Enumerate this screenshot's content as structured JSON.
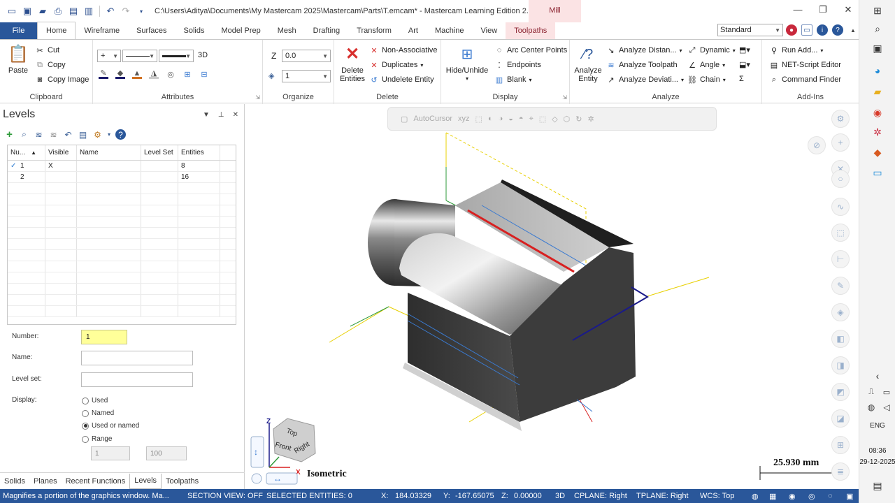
{
  "titlebar": {
    "title": "C:\\Users\\Aditya\\Documents\\My Mastercam 2025\\Mastercam\\Parts\\T.emcam* - Mastercam Learning Edition 2...",
    "context_tab_head": "Mill"
  },
  "tabs": [
    "File",
    "Home",
    "Wireframe",
    "Surfaces",
    "Solids",
    "Model Prep",
    "Mesh",
    "Drafting",
    "Transform",
    "Art",
    "Machine",
    "View",
    "Toolpaths"
  ],
  "workspace_select": "Standard",
  "ribbon": {
    "clipboard": {
      "paste": "Paste",
      "cut": "Cut",
      "copy": "Copy",
      "copy_image": "Copy Image",
      "label": "Clipboard"
    },
    "attributes": {
      "label": "Attributes",
      "dim_mode": "3D"
    },
    "organize": {
      "z_label": "Z",
      "z_value": "0.0",
      "level_value": "1",
      "label": "Organize"
    },
    "delete": {
      "delete_entities": "Delete\nEntities",
      "non_associative": "Non-Associative",
      "duplicates": "Duplicates",
      "undelete_entity": "Undelete Entity",
      "label": "Delete"
    },
    "display": {
      "hide_unhide": "Hide/Unhide",
      "arc_center_points": "Arc Center Points",
      "endpoints": "Endpoints",
      "blank": "Blank",
      "label": "Display"
    },
    "analyze": {
      "analyze_entity": "Analyze\nEntity",
      "analyze_distance": "Analyze Distan...",
      "analyze_toolpath": "Analyze Toolpath",
      "analyze_deviation": "Analyze Deviati...",
      "dynamic": "Dynamic",
      "angle": "Angle",
      "chain": "Chain",
      "label": "Analyze"
    },
    "addins": {
      "run_add": "Run Add...",
      "net_script": "NET-Script Editor",
      "command_finder": "Command Finder",
      "label": "Add-Ins"
    }
  },
  "levels_panel": {
    "title": "Levels",
    "columns": [
      "Nu...",
      "Visible",
      "Name",
      "Level Set",
      "Entities"
    ],
    "rows": [
      {
        "check": "✓",
        "number": "1",
        "visible": "X",
        "name": "",
        "level_set": "",
        "entities": "8"
      },
      {
        "check": "",
        "number": "2",
        "visible": "",
        "name": "",
        "level_set": "",
        "entities": "16"
      }
    ],
    "form": {
      "number_label": "Number:",
      "number_value": "1",
      "name_label": "Name:",
      "name_value": "",
      "level_set_label": "Level set:",
      "level_set_value": "",
      "display_label": "Display:",
      "options": [
        "Used",
        "Named",
        "Used or named",
        "Range"
      ],
      "selected_option": "Used or named",
      "range_from": "1",
      "range_to": "100"
    },
    "bottom_tabs": [
      "Solids",
      "Planes",
      "Recent Functions",
      "Levels",
      "Toolpaths"
    ],
    "active_bottom_tab": "Levels"
  },
  "viewport": {
    "autocursor": "AutoCursor",
    "view_name": "Isometric",
    "scale": "25.930 mm",
    "cube_faces": {
      "top": "Top",
      "front": "Front",
      "right": "Right"
    }
  },
  "statusbar": {
    "hint": "Magnifies a portion of the graphics window. Ma...",
    "section_view": "SECTION VIEW: OFF",
    "selected": "SELECTED ENTITIES: 0",
    "x_label": "X:",
    "x_value": "184.03329",
    "y_label": "Y:",
    "y_value": "-167.65075",
    "z_label": "Z:",
    "z_value": "0.00000",
    "mode": "3D",
    "cplane": "CPLANE: Right",
    "tplane": "TPLANE: Right",
    "wcs": "WCS: Top"
  },
  "taskbar": {
    "lang": "ENG",
    "time": "08:36",
    "date": "29-12-2025"
  },
  "colors": {
    "accent": "#2a579a",
    "context": "#fbe3e4",
    "context_text": "#8b2330",
    "highlight": "#ffff99"
  }
}
